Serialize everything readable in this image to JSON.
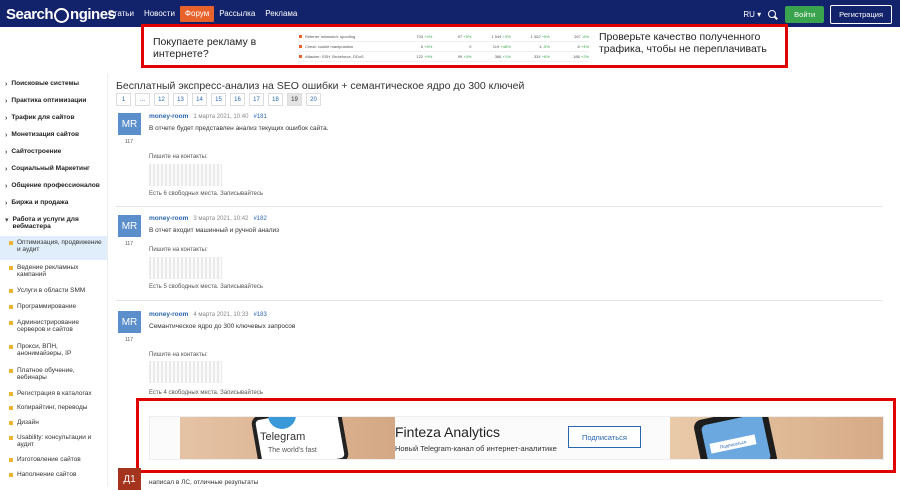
{
  "header": {
    "logo": "SearchEngines",
    "nav": [
      "Статьи",
      "Новости",
      "Форум",
      "Рассылка",
      "Реклама"
    ],
    "active_nav": "Форум",
    "lang": "RU ▾",
    "login": "Войти",
    "register": "Регистрация"
  },
  "top_ad": {
    "question": "Покупаете рекламу в интернете?",
    "rows": [
      {
        "name": "Referrer mismatch: spoofing",
        "v1": "703",
        "d1": "+4%",
        "v2": "97",
        "d2": "+5%",
        "v3": "1 544",
        "d3": "+3%",
        "v4": "1 302",
        "d4": "+5%",
        "v5": "267",
        "d5": "-6%"
      },
      {
        "name": "Cheat: cookie manipulation",
        "v1": "6",
        "d1": "+5%",
        "v2": "0",
        "d2": "",
        "v3": "119",
        "d3": "+48%",
        "v4": "4",
        "d4": "-5%",
        "v5": "8",
        "d5": "+4%"
      },
      {
        "name": "Attacker: SSH, Bruteforce, DDoS",
        "v1": "122",
        "d1": "+9%",
        "v2": "99",
        "d2": "+4%",
        "v3": "366",
        "d3": "+1%",
        "v4": "334",
        "d4": "+6%",
        "v5": "188",
        "d5": "+2%"
      }
    ],
    "tagline": "Проверьте качество полученного трафика, чтобы не переплачивать"
  },
  "sidebar": {
    "sections": [
      "Поисковые системы",
      "Практика оптимизации",
      "Трафик для сайтов",
      "Монетизация сайтов",
      "Сайтостроение",
      "Социальный Маркетинг",
      "Общение профессионалов",
      "Биржа и продажа",
      "Работа и услуги для вебмастера"
    ],
    "subitems": [
      "Оптимизация, продвижение и аудит",
      "Ведение рекламных кампаний",
      "Услуги в области SMM",
      "Программирование",
      "Администрирование серверов и сайтов",
      "Прокси, ВПН, анонимайзеры, IP",
      "Платное обучение, вебинары",
      "Регистрация в каталогах",
      "Копирайтинг, переводы",
      "Дизайн",
      "Usability: консультации и аудит",
      "Изготовление сайтов",
      "Наполнение сайтов"
    ]
  },
  "topic": {
    "title": "Бесплатный экспресс-анализ на SEO ошибки + семантическое ядро до 300 ключей",
    "pages": [
      "1",
      "...",
      "12",
      "13",
      "14",
      "15",
      "16",
      "17",
      "18",
      "19",
      "20"
    ],
    "current_page": "19"
  },
  "posts": [
    {
      "avatar": "MR",
      "count": "117",
      "author": "money-room",
      "date": "1 марта 2021, 10:40",
      "num": "#181",
      "text": "В отчете будет представлен анализ текущих ошибок сайта.",
      "contact": "Пишите на контакты:",
      "places": "Есть 6 свободных места. Записывайтесь"
    },
    {
      "avatar": "MR",
      "count": "117",
      "author": "money-room",
      "date": "3 марта 2021, 10:42",
      "num": "#182",
      "text": "В отчет входит машинный и ручной анализ",
      "contact": "Пишите на контакты:",
      "places": "Есть 5 свободных места. Записывайтесь"
    },
    {
      "avatar": "MR",
      "count": "117",
      "author": "money-room",
      "date": "4 марта 2021, 10:33",
      "num": "#183",
      "text": "Семантическое ядро до 300 ключевых запросов",
      "contact": "Пишите на контакты:",
      "places": "Есть 4 свободных места. Записывайтесь"
    }
  ],
  "bottom_ad": {
    "telegram": "Telegram",
    "telegram_sub": "The world's fast",
    "title": "Finteza Analytics",
    "subtitle": "Новый Telegram-канал об интернет-аналитике",
    "button": "Подписаться",
    "phone_button": "Подписаться"
  },
  "post4": {
    "avatar": "Д1",
    "text": "написал в ЛС, отличные результаты"
  }
}
